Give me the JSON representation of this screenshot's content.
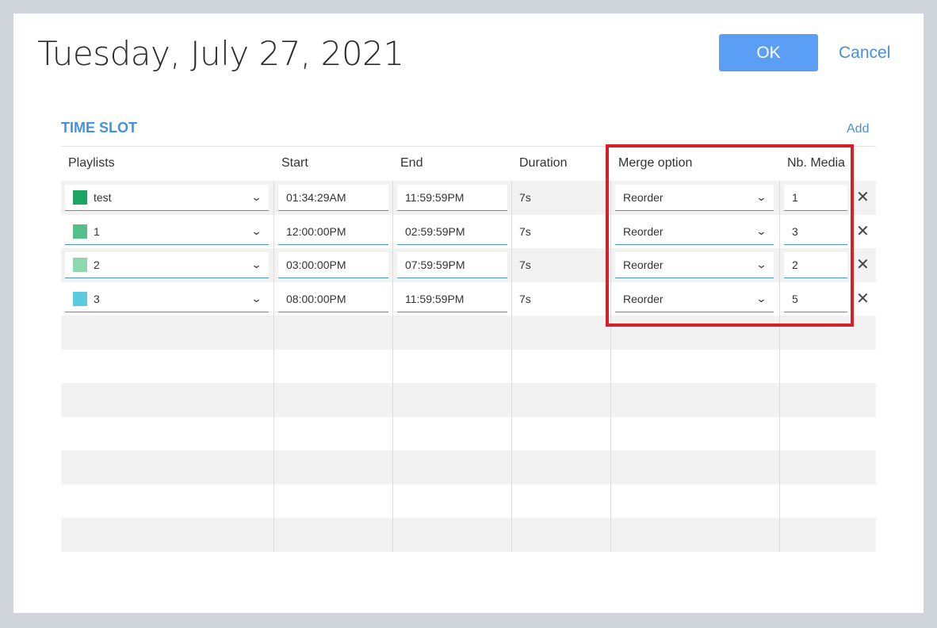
{
  "dialog": {
    "title": "Tuesday, July 27, 2021",
    "ok_label": "OK",
    "cancel_label": "Cancel"
  },
  "section": {
    "title": "TIME SLOT",
    "add_label": "Add"
  },
  "columns": [
    "Playlists",
    "Start",
    "End",
    "Duration",
    "Merge option",
    "Nb. Media"
  ],
  "rows": [
    {
      "playlist": "test",
      "color": "#1aa564",
      "start": "01:34:29AM",
      "end": "11:59:59PM",
      "duration": "7s",
      "merge": "Reorder",
      "nb": "1"
    },
    {
      "playlist": "1",
      "color": "#55c08a",
      "start": "12:00:00PM",
      "end": "02:59:59PM",
      "duration": "7s",
      "merge": "Reorder",
      "nb": "3"
    },
    {
      "playlist": "2",
      "color": "#8ed8ae",
      "start": "03:00:00PM",
      "end": "07:59:59PM",
      "duration": "7s",
      "merge": "Reorder",
      "nb": "2"
    },
    {
      "playlist": "3",
      "color": "#5ccbe0",
      "start": "08:00:00PM",
      "end": "11:59:59PM",
      "duration": "7s",
      "merge": "Reorder",
      "nb": "5"
    }
  ],
  "highlight_color": "#d62027"
}
